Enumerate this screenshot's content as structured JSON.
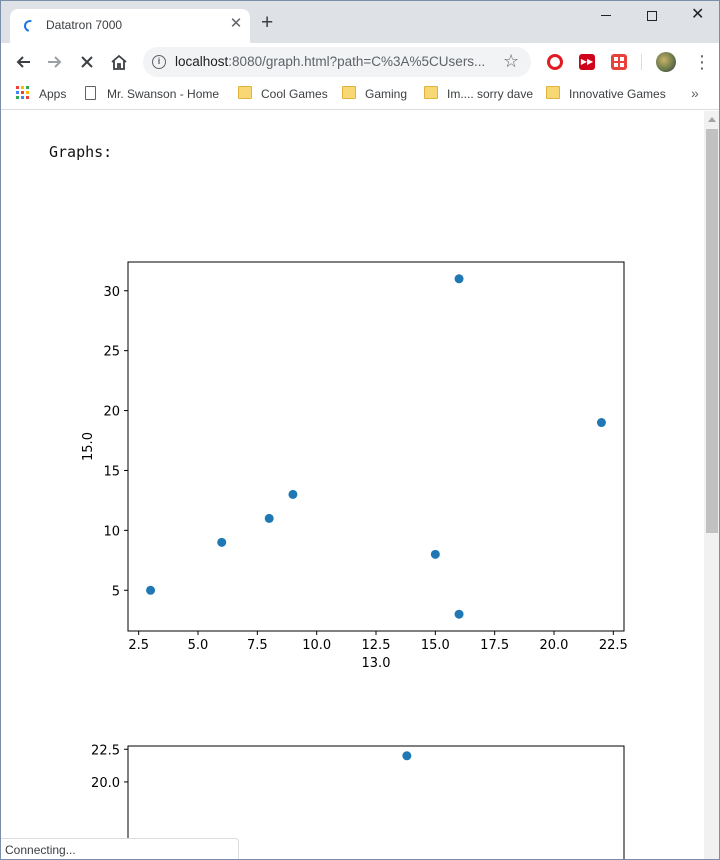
{
  "window": {
    "tab_title": "Datatron 7000",
    "new_tab_label": "+",
    "minimize_label": "",
    "maximize_label": "",
    "close_label": "✕"
  },
  "toolbar": {
    "url_host": "localhost",
    "url_rest": ":8080/graph.html?path=C%3A%5CUsers..."
  },
  "bookmarks": [
    {
      "label": "Apps",
      "icon": "apps-grid-icon"
    },
    {
      "label": "Mr. Swanson - Home",
      "icon": "page-icon"
    },
    {
      "label": "Cool Games",
      "icon": "folder-icon"
    },
    {
      "label": "Gaming",
      "icon": "folder-icon"
    },
    {
      "label": "Im.... sorry dave",
      "icon": "folder-icon"
    },
    {
      "label": "Innovative Games",
      "icon": "folder-icon"
    }
  ],
  "page": {
    "heading": "Graphs:"
  },
  "status": {
    "text": "Connecting..."
  },
  "colors": {
    "marker": "#1f77b4",
    "spinner": "#1a73e8"
  },
  "chart_data": [
    {
      "type": "scatter",
      "xlabel": "13.0",
      "ylabel": "15.0",
      "points": [
        [
          3,
          5
        ],
        [
          6,
          9
        ],
        [
          8,
          11
        ],
        [
          9,
          13
        ],
        [
          15,
          8
        ],
        [
          16,
          31
        ],
        [
          16,
          3
        ],
        [
          22,
          19
        ]
      ],
      "xlim": [
        2.05,
        22.95
      ],
      "ylim": [
        1.6,
        32.4
      ],
      "xticks": [
        "2.5",
        "5.0",
        "7.5",
        "10.0",
        "12.5",
        "15.0",
        "17.5",
        "20.0",
        "22.5"
      ],
      "xtick_values": [
        2.5,
        5,
        7.5,
        10,
        12.5,
        15,
        17.5,
        20,
        22.5
      ],
      "yticks": [
        "5",
        "10",
        "15",
        "20",
        "25",
        "30"
      ],
      "ytick_values": [
        5,
        10,
        15,
        20,
        25,
        30
      ]
    },
    {
      "type": "scatter",
      "points": [
        [
          13.8,
          22
        ]
      ],
      "xlim": [
        2.05,
        22.95
      ],
      "ylim": [
        12.8,
        22.75
      ],
      "yticks": [
        "20.0",
        "22.5"
      ],
      "ytick_values": [
        20,
        22.5
      ]
    }
  ]
}
